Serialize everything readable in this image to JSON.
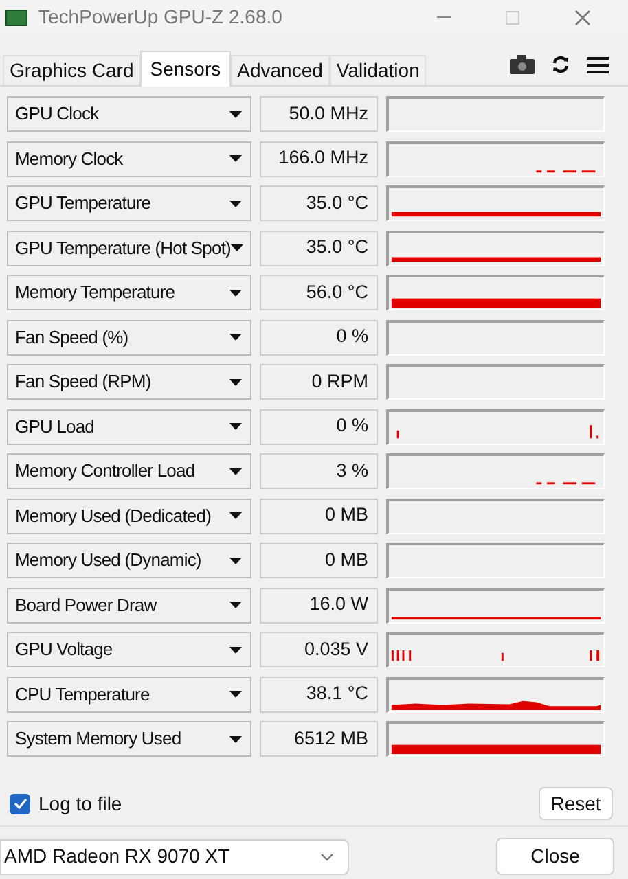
{
  "window": {
    "title": "TechPowerUp GPU-Z 2.68.0"
  },
  "tabs": [
    {
      "label": "Graphics Card",
      "selected": false
    },
    {
      "label": "Sensors",
      "selected": true
    },
    {
      "label": "Advanced",
      "selected": false
    },
    {
      "label": "Validation",
      "selected": false
    }
  ],
  "sensors": [
    {
      "name": "GPU Clock",
      "value": "50.0 MHz",
      "kind": "empty"
    },
    {
      "name": "Memory Clock",
      "value": "166.0 MHz",
      "kind": "dashes"
    },
    {
      "name": "GPU Temperature",
      "value": "35.0 °C",
      "kind": "bar"
    },
    {
      "name": "GPU Temperature (Hot Spot)",
      "value": "35.0 °C",
      "kind": "bar"
    },
    {
      "name": "Memory Temperature",
      "value": "56.0 °C",
      "kind": "thick"
    },
    {
      "name": "Fan Speed (%)",
      "value": "0 %",
      "kind": "empty"
    },
    {
      "name": "Fan Speed (RPM)",
      "value": "0 RPM",
      "kind": "empty"
    },
    {
      "name": "GPU Load",
      "value": "0 %",
      "kind": "spikes"
    },
    {
      "name": "Memory Controller Load",
      "value": "3 %",
      "kind": "dashes"
    },
    {
      "name": "Memory Used (Dedicated)",
      "value": "0 MB",
      "kind": "empty"
    },
    {
      "name": "Memory Used (Dynamic)",
      "value": "0 MB",
      "kind": "empty"
    },
    {
      "name": "Board Power Draw",
      "value": "16.0 W",
      "kind": "line"
    },
    {
      "name": "GPU Voltage",
      "value": "0.035 V",
      "kind": "ticks"
    },
    {
      "name": "CPU Temperature",
      "value": "38.1 °C",
      "kind": "wave"
    },
    {
      "name": "System Memory Used",
      "value": "6512 MB",
      "kind": "thick"
    }
  ],
  "log_to_file": {
    "label": "Log to file",
    "checked": true
  },
  "reset_button": "Reset",
  "gpu_select": {
    "value": "AMD Radeon RX 9070 XT"
  },
  "close_button": "Close"
}
